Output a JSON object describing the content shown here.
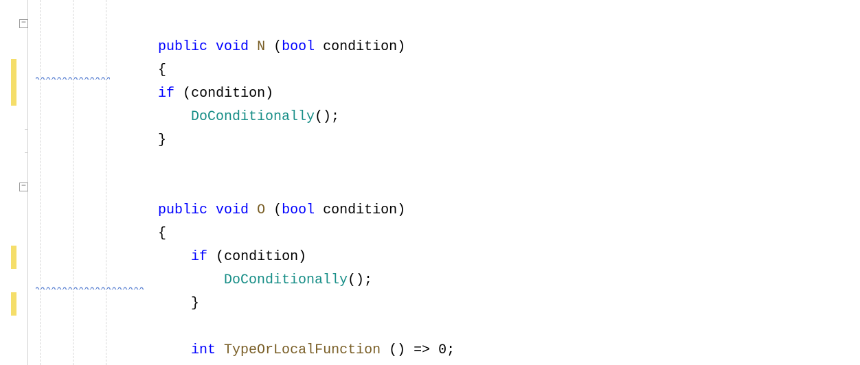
{
  "icons": {
    "minus": "−"
  },
  "squiggle_color": "#6a8dd6",
  "change_bar_color": "#f5de6a",
  "code": {
    "line1": {
      "kw1": "public",
      "kw2": "void",
      "name": "N",
      "paren_open": "(",
      "kw3": "bool",
      "param": "condition",
      "paren_close": ")"
    },
    "line2": {
      "brace": "{"
    },
    "line3": {
      "kw": "if",
      "open": "(",
      "cond": "condition",
      "close": ")"
    },
    "line4": {
      "call": "DoConditionally",
      "parens": "();"
    },
    "line5": {
      "brace": "}"
    },
    "line7": {
      "kw1": "public",
      "kw2": "void",
      "name": "O",
      "paren_open": "(",
      "kw3": "bool",
      "param": "condition",
      "paren_close": ")"
    },
    "line8": {
      "brace": "{"
    },
    "line9": {
      "kw": "if",
      "open": "(",
      "cond": "condition",
      "close": ")"
    },
    "line10": {
      "call": "DoConditionally",
      "parens": "();"
    },
    "line11": {
      "brace": "}"
    },
    "line13": {
      "kw": "int",
      "name": "TypeOrLocalFunction",
      "rest": " () => 0;"
    }
  }
}
